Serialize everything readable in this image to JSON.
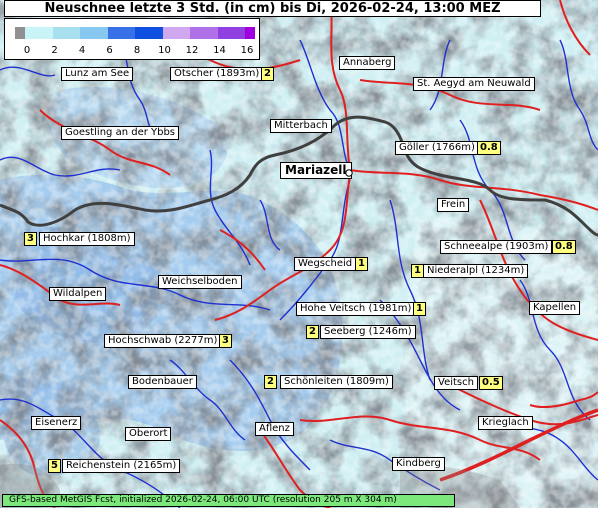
{
  "title": "Neuschnee letzte 3 Std. (in cm) bis Di, 2026-02-24, 13:00 MEZ",
  "legend": {
    "ticks": [
      "0",
      "2",
      "4",
      "6",
      "8",
      "10",
      "12",
      "14",
      "16"
    ],
    "colors": [
      "#c8f4f8",
      "#a8e0f0",
      "#88c8f0",
      "#3870e8",
      "#1050e0",
      "#d0a8f0",
      "#b070e8",
      "#9040e0",
      "#7000d8"
    ],
    "left_color": "#909090",
    "right_color": "#a000e0"
  },
  "places": [
    {
      "name": "Lunz am See"
    },
    {
      "name": "Ötscher (1893m)",
      "value": "2"
    },
    {
      "name": "Annaberg"
    },
    {
      "name": "St. Aegyd am Neuwald"
    },
    {
      "name": "Goestling an der Ybbs"
    },
    {
      "name": "Mitterbach"
    },
    {
      "name": "Göller (1766m)",
      "value": "0.8"
    },
    {
      "name": "Mariazell"
    },
    {
      "name": "Frein"
    },
    {
      "name": "Hochkar (1808m)",
      "value": "3"
    },
    {
      "name": "Schneealpe (1903m)",
      "value": "0.8"
    },
    {
      "name": "Wegscheid",
      "value": "1"
    },
    {
      "name": "Niederalpl (1234m)",
      "value": "1"
    },
    {
      "name": "Weichselboden"
    },
    {
      "name": "Wildalpen"
    },
    {
      "name": "Hohe Veitsch (1981m)",
      "value": "1"
    },
    {
      "name": "Kapellen"
    },
    {
      "name": "Seeberg (1246m)",
      "value": "2"
    },
    {
      "name": "Hochschwab (2277m)",
      "value": "3"
    },
    {
      "name": "Bodenbauer"
    },
    {
      "name": "Schönleiten (1809m)",
      "value": "2"
    },
    {
      "name": "Veitsch",
      "value": "0.5"
    },
    {
      "name": "Eisenerz"
    },
    {
      "name": "Oberort"
    },
    {
      "name": "Aflenz"
    },
    {
      "name": "Krieglach"
    },
    {
      "name": "Reichenstein (2165m)",
      "value": "5"
    },
    {
      "name": "Kindberg"
    }
  ],
  "footer": "GFS-based MetGIS Fcst, initialized 2026-02-24, 06:00 UTC  (resolution 205 m X 304 m)",
  "colors": {
    "roads": "#e02020",
    "rivers": "#2030d0",
    "border": "#404040",
    "snow_light": "#c8f0f4",
    "snow_medium": "#9cc4ec",
    "footer_bg": "#7ce87c",
    "value_bg": "#ffff80"
  }
}
